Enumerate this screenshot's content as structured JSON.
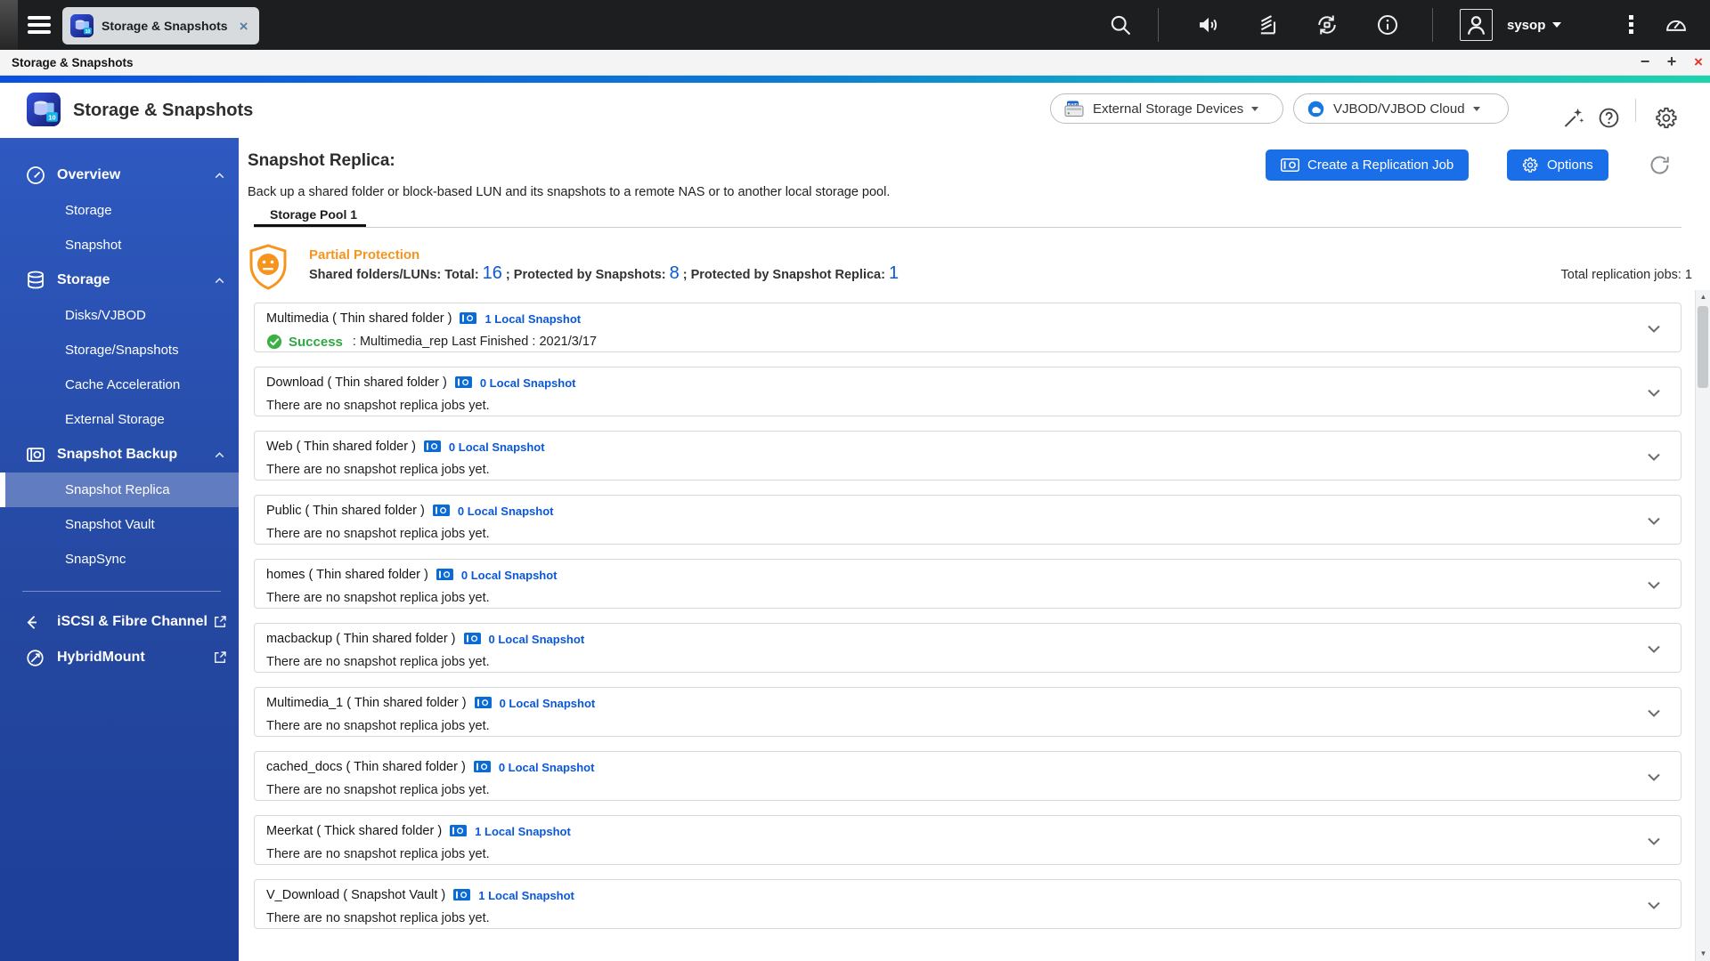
{
  "colors": {
    "accent_blue": "#1a6fe8",
    "link_blue": "#0a58d8",
    "warning_orange": "#f7941d",
    "success_green": "#2fa844",
    "sidebar_blue_top": "#2e59c0",
    "sidebar_blue_bottom": "#1d3e99"
  },
  "taskbar": {
    "tab_title": "Storage & Snapshots",
    "username": "sysop",
    "icons": [
      "search-icon",
      "volume-icon",
      "background-tasks-icon",
      "sync-icon",
      "info-icon",
      "user-avatar",
      "more-menu-icon",
      "resource-monitor-icon"
    ]
  },
  "window": {
    "title": "Storage & Snapshots",
    "controls": {
      "minimize": "−",
      "maximize": "+",
      "close": "×"
    }
  },
  "app_header": {
    "title": "Storage & Snapshots",
    "external_devices_button": "External Storage Devices",
    "vjbod_button": "VJBOD/VJBOD Cloud",
    "icons": [
      "raid-device-icon",
      "vjbod-cloud-icon",
      "wand-icon",
      "help-icon",
      "gear-icon"
    ]
  },
  "sidebar": {
    "sections": [
      {
        "id": "overview",
        "label": "Overview",
        "icon": "gauge-icon",
        "children": [
          {
            "id": "overview-storage",
            "label": "Storage"
          },
          {
            "id": "overview-snapshot",
            "label": "Snapshot"
          }
        ]
      },
      {
        "id": "storage",
        "label": "Storage",
        "icon": "database-icon",
        "children": [
          {
            "id": "disks-vjbod",
            "label": "Disks/VJBOD"
          },
          {
            "id": "storage-snapshots",
            "label": "Storage/Snapshots"
          },
          {
            "id": "cache-acceleration",
            "label": "Cache Acceleration"
          },
          {
            "id": "external-storage",
            "label": "External Storage"
          }
        ]
      },
      {
        "id": "snapshot-backup",
        "label": "Snapshot Backup",
        "icon": "camera-icon",
        "children": [
          {
            "id": "snapshot-replica",
            "label": "Snapshot Replica",
            "selected": true
          },
          {
            "id": "snapshot-vault",
            "label": "Snapshot Vault"
          },
          {
            "id": "snapsync",
            "label": "SnapSync"
          }
        ]
      }
    ],
    "external_links": [
      {
        "id": "iscsi-fibre-channel",
        "label": "iSCSI & Fibre Channel",
        "icon": "iscsi-icon"
      },
      {
        "id": "hybridmount",
        "label": "HybridMount",
        "icon": "hybridmount-icon"
      }
    ]
  },
  "main": {
    "title": "Snapshot Replica:",
    "description": "Back up a shared folder or block-based LUN and its snapshots to a remote NAS or to another local storage pool.",
    "pool_tab": "Storage Pool 1",
    "create_job_button": "Create a Replication Job",
    "options_button": "Options",
    "protection_status": "Partial Protection",
    "stats": {
      "prefix": "Shared folders/LUNs: Total:",
      "total": "16",
      "mid1": "; Protected by Snapshots:",
      "snapshots": "8",
      "mid2": "; Protected by Snapshot Replica:",
      "replica": "1"
    },
    "total_jobs": "Total replication jobs: 1",
    "empty_job_text": "There are no snapshot replica jobs yet.",
    "rows": [
      {
        "name": "Multimedia ( Thin shared folder )",
        "link": "1 Local Snapshot",
        "status": "Success",
        "status_detail": " : Multimedia_rep Last Finished : 2021/3/17"
      },
      {
        "name": "Download ( Thin shared folder )",
        "link": "0 Local Snapshot"
      },
      {
        "name": "Web ( Thin shared folder )",
        "link": "0 Local Snapshot"
      },
      {
        "name": "Public ( Thin shared folder )",
        "link": "0 Local Snapshot"
      },
      {
        "name": "homes ( Thin shared folder )",
        "link": "0 Local Snapshot"
      },
      {
        "name": "macbackup ( Thin shared folder )",
        "link": "0 Local Snapshot"
      },
      {
        "name": "Multimedia_1 ( Thin shared folder )",
        "link": "0 Local Snapshot"
      },
      {
        "name": "cached_docs ( Thin shared folder )",
        "link": "0 Local Snapshot"
      },
      {
        "name": "Meerkat ( Thick shared folder )",
        "link": "1 Local Snapshot"
      },
      {
        "name": "V_Download ( Snapshot Vault )",
        "link": "1 Local Snapshot"
      }
    ]
  }
}
